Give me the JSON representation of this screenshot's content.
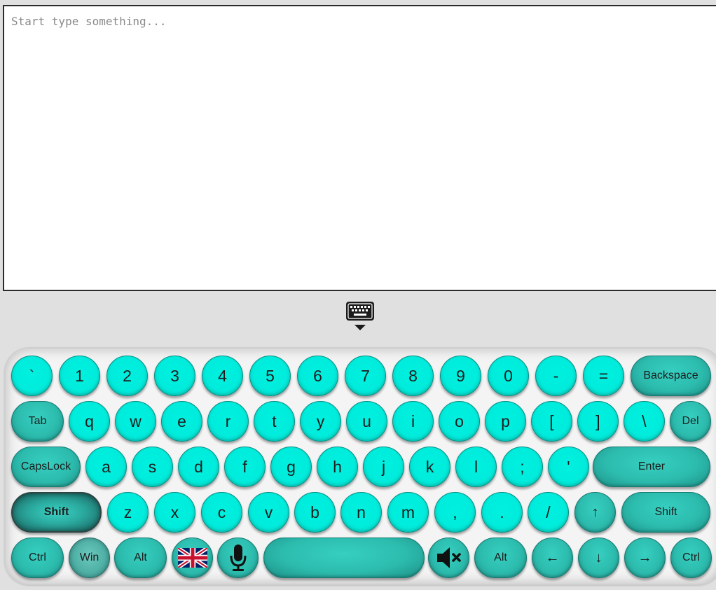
{
  "text_area": {
    "placeholder": "Start type something...",
    "value": ""
  },
  "toggle": {
    "icon": "keyboard-hide-icon"
  },
  "keyboard": {
    "colors": {
      "key": "#00f0e0",
      "function_key": "#2cbcae",
      "frame": "#f4f4f4"
    },
    "rows": [
      [
        "`",
        "1",
        "2",
        "3",
        "4",
        "5",
        "6",
        "7",
        "8",
        "9",
        "0",
        "-",
        "=",
        "Backspace"
      ],
      [
        "Tab",
        "q",
        "w",
        "e",
        "r",
        "t",
        "y",
        "u",
        "i",
        "o",
        "p",
        "[",
        "]",
        "\\",
        "Del"
      ],
      [
        "CapsLock",
        "a",
        "s",
        "d",
        "f",
        "g",
        "h",
        "j",
        "k",
        "l",
        ";",
        "'",
        "Enter"
      ],
      [
        "Shift",
        "z",
        "x",
        "c",
        "v",
        "b",
        "n",
        "m",
        ",",
        ".",
        "/",
        "↑",
        "Shift"
      ],
      [
        "Ctrl",
        "Win",
        "Alt",
        "flag",
        "mic",
        "space",
        "mute",
        "Alt",
        "←",
        "↓",
        "→",
        "Ctrl"
      ]
    ],
    "language": {
      "icon": "uk-flag-icon",
      "label": "English (UK)"
    },
    "microphone": {
      "icon": "microphone-icon"
    },
    "sound": {
      "icon": "speaker-muted-icon"
    },
    "shift_active": true
  }
}
